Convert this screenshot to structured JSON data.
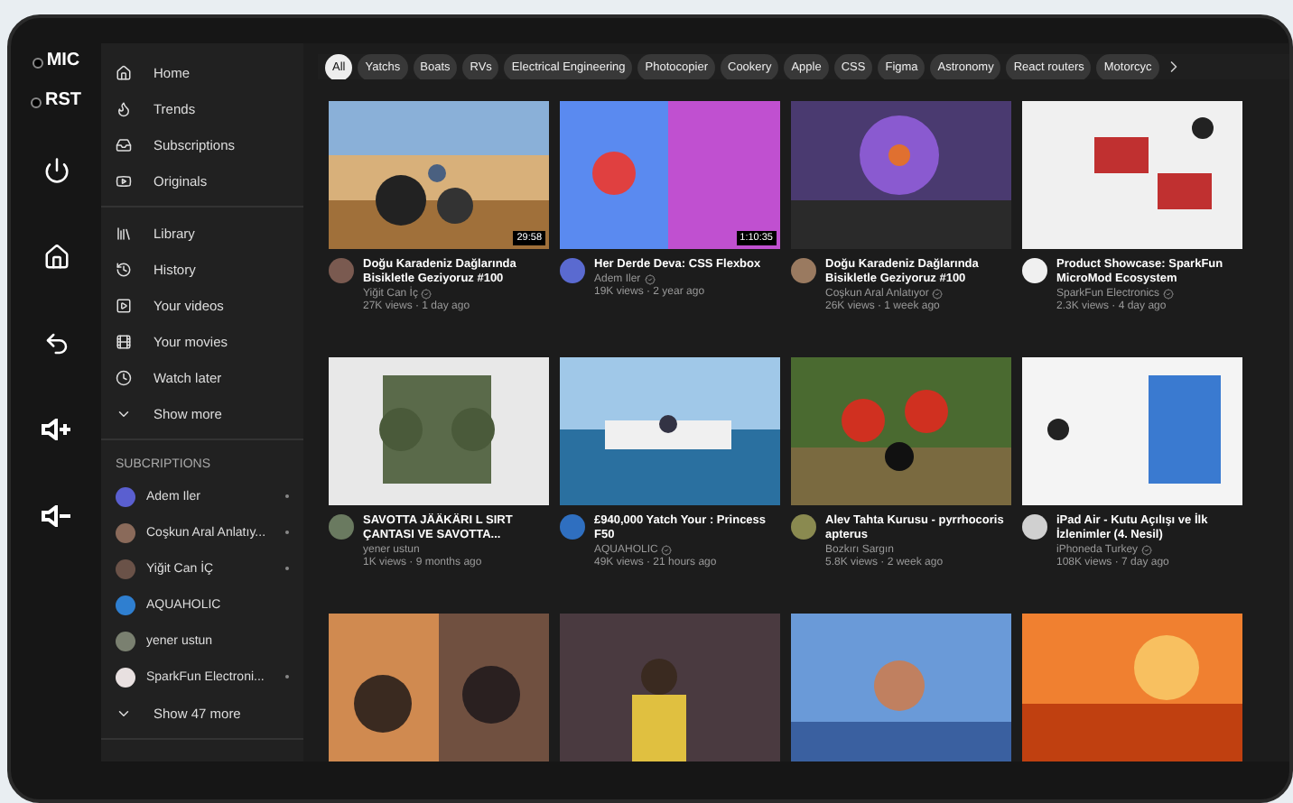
{
  "hardware_buttons": [
    {
      "kind": "label",
      "label": "MIC"
    },
    {
      "kind": "label",
      "label": "RST"
    },
    {
      "kind": "power"
    },
    {
      "kind": "home"
    },
    {
      "kind": "back"
    },
    {
      "kind": "volume_up"
    },
    {
      "kind": "volume_down"
    }
  ],
  "sidebar": {
    "main": [
      {
        "label": "Home"
      },
      {
        "label": "Trends"
      },
      {
        "label": "Subscriptions"
      },
      {
        "label": "Originals"
      }
    ],
    "library": [
      {
        "label": "Library"
      },
      {
        "label": "History"
      },
      {
        "label": "Your videos"
      },
      {
        "label": "Your movies"
      },
      {
        "label": "Watch later"
      },
      {
        "label": "Show more"
      }
    ],
    "subscriptions_heading": "SUBCRIPTIONS",
    "subscriptions": [
      {
        "name": "Adem Iler",
        "color": "#5a5fd0",
        "new": true
      },
      {
        "name": "Coşkun Aral Anlatıy...",
        "color": "#8a6a5a",
        "new": true
      },
      {
        "name": "Yiğit Can İÇ",
        "color": "#6a5248",
        "new": true
      },
      {
        "name": "AQUAHOLIC",
        "color": "#2f7fd0",
        "new": false
      },
      {
        "name": "yener ustun",
        "color": "#7a8070",
        "new": false
      },
      {
        "name": "SparkFun Electroni...",
        "color": "#e8e0e0",
        "new": true
      }
    ],
    "show_more": "Show 47 more"
  },
  "chips": [
    {
      "label": "All",
      "selected": true
    },
    {
      "label": "Yatchs",
      "selected": false
    },
    {
      "label": "Boats",
      "selected": false
    },
    {
      "label": "RVs",
      "selected": false
    },
    {
      "label": "Electrical Engineering",
      "selected": false
    },
    {
      "label": "Photocopier",
      "selected": false
    },
    {
      "label": "Cookery",
      "selected": false
    },
    {
      "label": "Apple",
      "selected": false
    },
    {
      "label": "CSS",
      "selected": false
    },
    {
      "label": "Figma",
      "selected": false
    },
    {
      "label": "Astronomy",
      "selected": false
    },
    {
      "label": "React routers",
      "selected": false
    },
    {
      "label": "Motorcyc",
      "selected": false
    }
  ],
  "videos": [
    {
      "kind": "video",
      "duration": "29:58",
      "title": "Doğu Karadeniz Dağlarında Bisikletle Geziyoruz #100",
      "channel": "Yiğit Can İç",
      "verified": true,
      "stats": "27K views · 1 day ago"
    },
    {
      "kind": "video",
      "duration": "1:10:35",
      "title": "Her Derde Deva: CSS Flexbox",
      "channel": "Adem Iler",
      "verified": true,
      "stats": "19K views · 2 year ago"
    },
    {
      "kind": "video",
      "title": "Doğu Karadeniz Dağlarında Bisikletle Geziyoruz #100",
      "channel": "Coşkun Aral Anlatıyor",
      "verified": true,
      "stats": "26K views · 1 week ago"
    },
    {
      "kind": "video",
      "title": "Product Showcase: SparkFun MicroMod Ecosystem",
      "channel": "SparkFun Electronics",
      "verified": true,
      "stats": "2.3K views · 4 day ago"
    },
    {
      "kind": "video",
      "title": "SAVOTTA JÄÄKÄRI L SIRT ÇANTASI VE SAVOTTA...",
      "channel": "yener ustun",
      "verified": false,
      "stats": "1K views · 9 months ago"
    },
    {
      "kind": "video",
      "title": "£940,000 Yatch Your : Princess F50",
      "channel": "AQUAHOLIC",
      "verified": true,
      "stats": "49K views · 21 hours ago"
    },
    {
      "kind": "video",
      "title": "Alev Tahta Kurusu - pyrrhocoris apterus",
      "channel": "Bozkırı Sargın",
      "verified": false,
      "stats": "5.8K views · 2 week ago"
    },
    {
      "kind": "video",
      "title": "iPad Air - Kutu Açılışı ve İlk İzlenimler (4. Nesil)",
      "channel": "iPhoneda Turkey",
      "verified": true,
      "stats": "108K views · 7 day ago"
    },
    {
      "kind": "picture"
    },
    {
      "kind": "picture"
    },
    {
      "kind": "picture"
    },
    {
      "kind": "picture"
    }
  ]
}
